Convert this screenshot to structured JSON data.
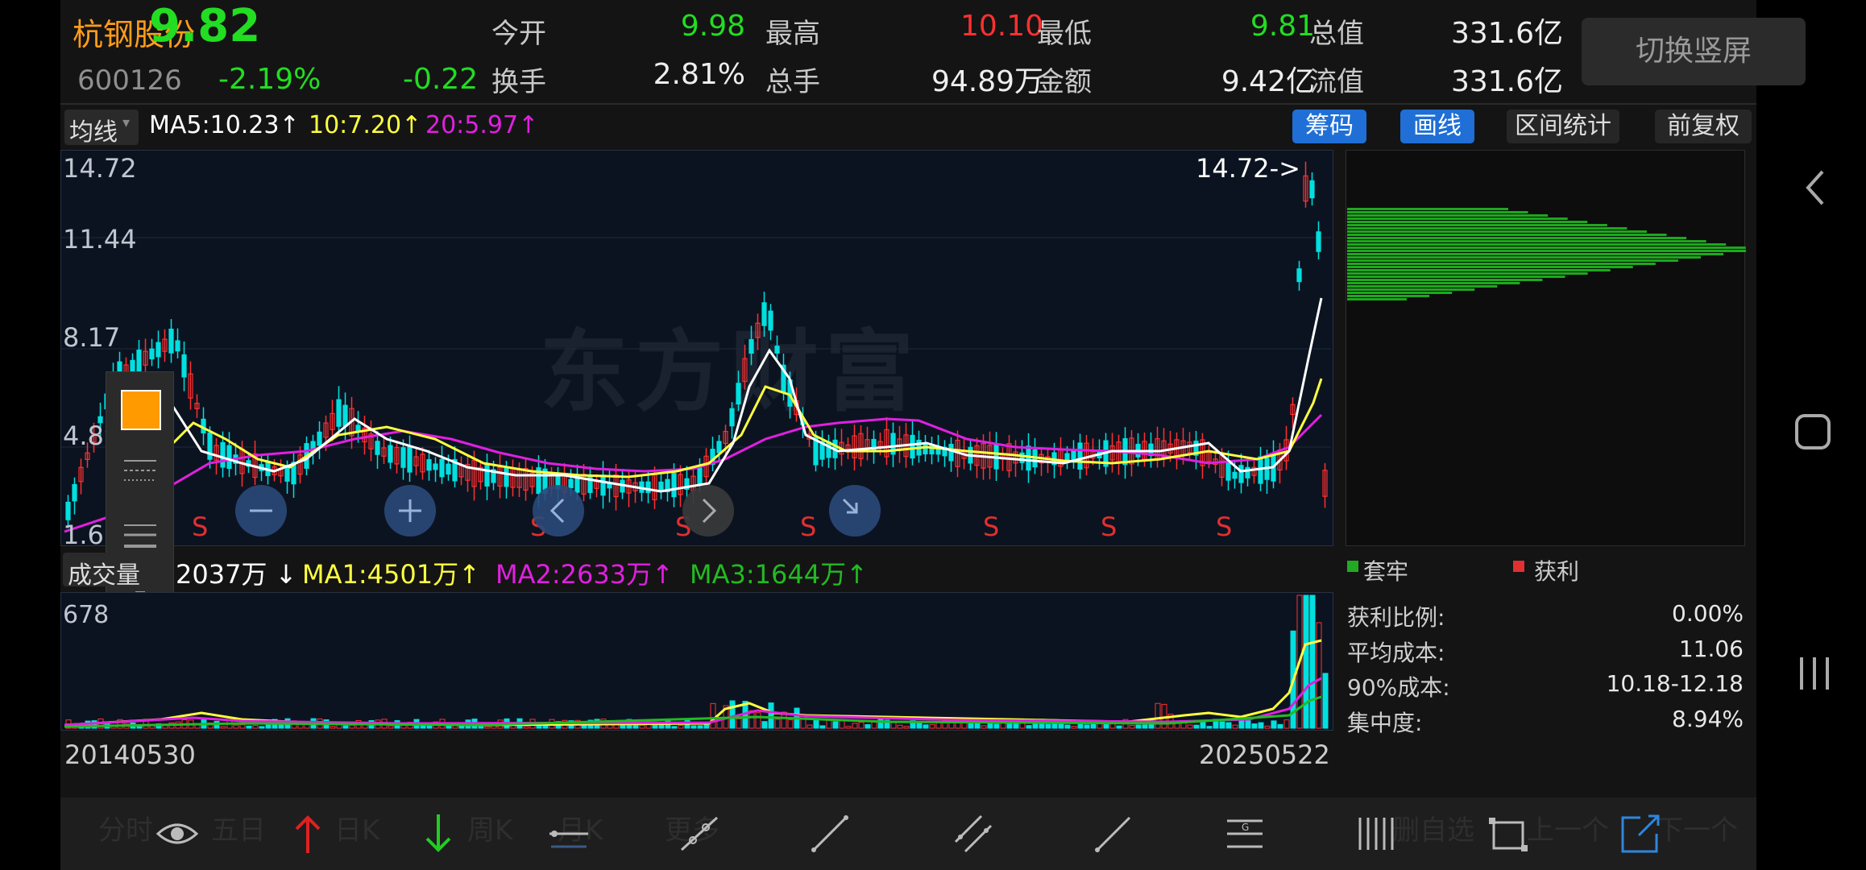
{
  "stock": {
    "name": "杭钢股份",
    "price": "9.82",
    "code": "600126",
    "change_pct": "-2.19%",
    "change": "-0.22"
  },
  "quote": {
    "open_label": "今开",
    "open": "9.98",
    "high_label": "最高",
    "high": "10.10",
    "low_label": "最低",
    "low": "9.81",
    "total_cap_label": "总值",
    "total_cap": "331.6亿",
    "turnover_label": "换手",
    "turnover": "2.81%",
    "volume_label": "总手",
    "volume": "94.89万",
    "amount_label": "金额",
    "amount": "9.42亿",
    "float_cap_label": "流值",
    "float_cap": "331.6亿"
  },
  "switch_button": "切换竖屏",
  "ma_bar": {
    "selector": "均线",
    "ma5": "MA5:10.23",
    "ma10": "10:7.20",
    "ma20": "20:5.97",
    "arrow_up": "↑"
  },
  "tags": {
    "chips": "筹码",
    "draw": "画线",
    "interval": "区间统计",
    "adjust": "前复权"
  },
  "price_axis": [
    "14.72",
    "11.44",
    "8.17",
    "4.89",
    "1.6"
  ],
  "max_marker": "14.72->",
  "watermark": "东方财富",
  "sell_marker": "S",
  "volume_bar": {
    "label": "成交量",
    "current": "2037万",
    "arrow_down": "↓",
    "ma1": "MA1:4501万",
    "ma2": "MA2:2633万",
    "ma3": "MA3:1644万",
    "arrow_up": "↑",
    "axis_top": "678"
  },
  "date_start": "20140530",
  "date_end": "20250522",
  "chip_legend": {
    "trapped": "套牢",
    "profit": "获利"
  },
  "chip_stats": [
    {
      "label": "获利比例:",
      "value": "0.00%"
    },
    {
      "label": "平均成本:",
      "value": "11.06"
    },
    {
      "label": "90%成本:",
      "value": "10.18-12.18"
    },
    {
      "label": "集中度:",
      "value": "8.94%"
    }
  ],
  "toolbar_ghost": [
    "分时",
    "五日",
    "日K",
    "周K",
    "月K",
    "更多",
    "删自选",
    "上一个",
    "下一个"
  ],
  "colors": {
    "up": "#ff3030",
    "down": "#00e0e0",
    "green": "#22cc22",
    "ma5": "#ffffff",
    "ma10": "#ffff40",
    "ma20": "#e020e0",
    "accent_blue": "#1f6fd6"
  }
}
